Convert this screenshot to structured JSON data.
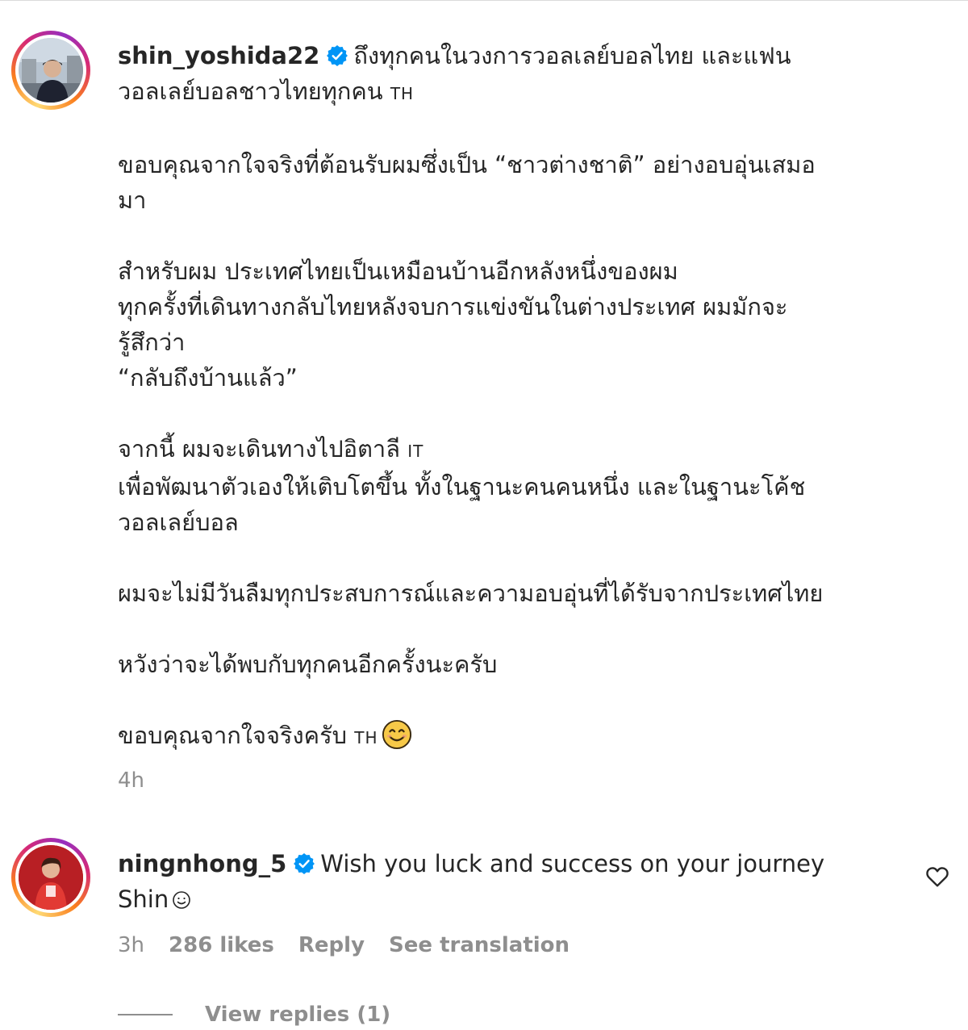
{
  "comments": [
    {
      "username": "shin_yoshida22",
      "verified": true,
      "lines": [
        "ถึงทุกคนในวงการวอลเลย์บอลไทย และแฟน",
        "วอลเลย์บอลชาวไทยทุกคน",
        "",
        "ขอบคุณจากใจจริงที่ต้อนรับผมซึ่งเป็น “ชาวต่างชาติ” อย่างอบอุ่นเสมอ",
        "มา",
        "",
        "สำหรับผม ประเทศไทยเป็นเหมือนบ้านอีกหลังหนึ่งของผม",
        "ทุกครั้งที่เดินทางกลับไทยหลังจบการแข่งขันในต่างประเทศ ผมมักจะ",
        "รู้สึกว่า",
        "“กลับถึงบ้านแล้ว”",
        "",
        "จากนี้ ผมจะเดินทางไปอิตาลี",
        "เพื่อพัฒนาตัวเองให้เติบโตขึ้น ทั้งในฐานะคนคนหนึ่ง และในฐานะโค้ช",
        "วอลเลย์บอล",
        "",
        "ผมจะไม่มีวันลืมทุกประสบการณ์และความอบอุ่นที่ได้รับจากประเทศไทย",
        "",
        "หวังว่าจะได้พบกับทุกคนอีกครั้งนะครับ",
        "",
        "ขอบคุณจากใจจริงครับ"
      ],
      "flag_th": "TH",
      "flag_it": "IT",
      "emoji_end": "smiling-face-icon",
      "time": "4h"
    },
    {
      "username": "ningnhong_5",
      "verified": true,
      "text_line1": "Wish you luck and success on your journey",
      "text_line2": "Shin",
      "emoji_end": "smiling-face-outline-icon",
      "time": "3h",
      "likes": "286 likes",
      "reply_label": "Reply",
      "translate_label": "See translation",
      "view_replies_label": "View replies (1)",
      "like_icon": "heart-outline-icon"
    }
  ],
  "colors": {
    "text": "#262626",
    "secondary": "#8e8e8e",
    "verified": "#0095f6"
  }
}
